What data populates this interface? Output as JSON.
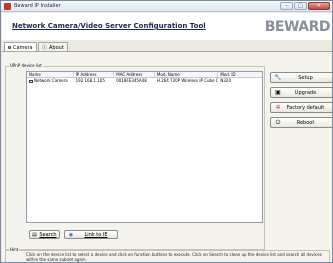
{
  "window": {
    "title": "Beward IP Installer"
  },
  "header": {
    "title": "Network Camera/Video Server Configuration Tool",
    "logo": "BEWARD"
  },
  "tabs": [
    {
      "label": "Camera"
    },
    {
      "label": "About"
    }
  ],
  "device_list": {
    "group_label": "UPnP device list",
    "columns": [
      "Name",
      "IP Address",
      "MAC Address",
      "Mod. Name",
      "Mod. ID"
    ],
    "rows": [
      {
        "name": "Network Camera",
        "ip": "192.168.1.105",
        "mac": "0018FE345A48",
        "model": "H.264 720P Wireless IP Cube Cam...",
        "id": "N320"
      }
    ]
  },
  "actions": {
    "setup": "Setup",
    "upgrade": "Upgrade",
    "factory_default": "Factory default",
    "reboot": "Reboot",
    "search": "Search",
    "link_ie": "Link to IE"
  },
  "hint": {
    "group_label": "Hint",
    "text": "Click on the device list to select a device and click on function buttons to execute. Click on Search to clean up the device list and search all devices within the same subnet again."
  },
  "icons": {
    "app": "beward-app-icon",
    "setup": "wrench-icon",
    "upgrade": "upgrade-icon",
    "factory_default": "factory-gear-icon",
    "reboot": "power-icon",
    "search": "search-icon",
    "link_ie": "globe-icon"
  }
}
